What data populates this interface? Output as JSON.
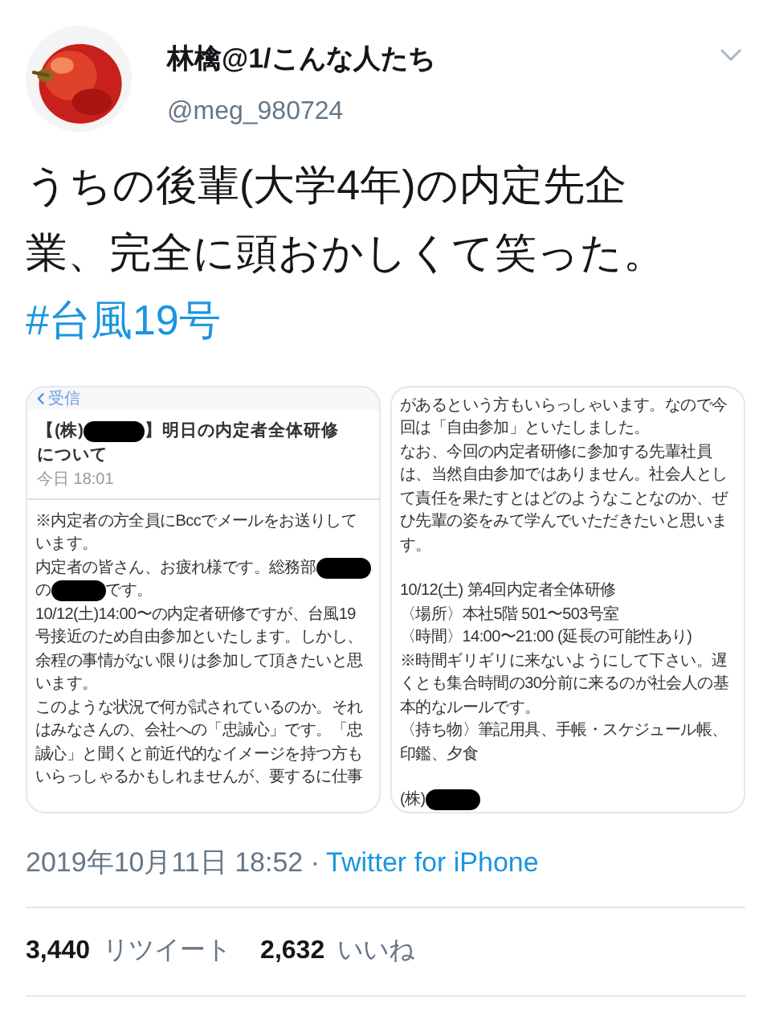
{
  "author": {
    "name": "林檎@1/こんな人たち",
    "handle": "@meg_980724"
  },
  "tweet": {
    "text": "うちの後輩(大学4年)の内定先企業、完全に頭おかしくて笑った。",
    "hashtag": "#台風19号"
  },
  "images": [
    {
      "kind": "mail_header",
      "back_label": "受信",
      "subject_before": "【(株)",
      "subject_after": "】明日の内定者全体研修",
      "subject_continued": "について",
      "time": "今日 18:01",
      "lines": [
        {
          "kind": "text",
          "parts": [
            {
              "kind": "text",
              "text": "※内定者の方全員にBccでメールをお送りして"
            }
          ]
        },
        {
          "kind": "text",
          "parts": [
            {
              "kind": "text",
              "text": "います。"
            }
          ]
        },
        {
          "kind": "text",
          "parts": [
            {
              "kind": "text",
              "text": "内定者の皆さん、お疲れ様です。総務部"
            },
            {
              "kind": "redaction"
            }
          ]
        },
        {
          "kind": "text",
          "parts": [
            {
              "kind": "text",
              "text": "の"
            },
            {
              "kind": "redaction"
            },
            {
              "kind": "text",
              "text": "です。"
            }
          ]
        },
        {
          "kind": "text",
          "parts": [
            {
              "kind": "text",
              "text": "10/12(土)14:00〜の内定者研修ですが、台風19"
            }
          ]
        },
        {
          "kind": "text",
          "parts": [
            {
              "kind": "text",
              "text": "号接近のため自由参加といたします。しかし、"
            }
          ]
        },
        {
          "kind": "text",
          "parts": [
            {
              "kind": "text",
              "text": "余程の事情がない限りは参加して頂きたいと思"
            }
          ]
        },
        {
          "kind": "text",
          "parts": [
            {
              "kind": "text",
              "text": "います。"
            }
          ]
        },
        {
          "kind": "text",
          "parts": [
            {
              "kind": "text",
              "text": "このような状況で何が試されているのか。それ"
            }
          ]
        },
        {
          "kind": "text",
          "parts": [
            {
              "kind": "text",
              "text": "はみなさんの、会社への「忠誠心」です。「忠"
            }
          ]
        },
        {
          "kind": "text",
          "parts": [
            {
              "kind": "text",
              "text": "誠心」と聞くと前近代的なイメージを持つ方も"
            }
          ]
        },
        {
          "kind": "text",
          "parts": [
            {
              "kind": "text",
              "text": "いらっしゃるかもしれませんが、要するに仕事"
            }
          ]
        }
      ]
    },
    {
      "kind": "mail_body",
      "lines": [
        {
          "kind": "text",
          "parts": [
            {
              "kind": "text",
              "text": "があるという方もいらっしゃいます。なので今"
            }
          ]
        },
        {
          "kind": "text",
          "parts": [
            {
              "kind": "text",
              "text": "回は「自由参加」といたしました。"
            }
          ]
        },
        {
          "kind": "text",
          "parts": [
            {
              "kind": "text",
              "text": "なお、今回の内定者研修に参加する先輩社員"
            }
          ]
        },
        {
          "kind": "text",
          "parts": [
            {
              "kind": "text",
              "text": "は、当然自由参加ではありません。社会人とし"
            }
          ]
        },
        {
          "kind": "text",
          "parts": [
            {
              "kind": "text",
              "text": "て責任を果たすとはどのようなことなのか、ぜ"
            }
          ]
        },
        {
          "kind": "text",
          "parts": [
            {
              "kind": "text",
              "text": "ひ先輩の姿をみて学んでいただきたいと思いま"
            }
          ]
        },
        {
          "kind": "text",
          "parts": [
            {
              "kind": "text",
              "text": "す。"
            }
          ]
        },
        {
          "kind": "gap"
        },
        {
          "kind": "text",
          "parts": [
            {
              "kind": "text",
              "text": "10/12(土) 第4回内定者全体研修"
            }
          ]
        },
        {
          "kind": "text",
          "parts": [
            {
              "kind": "text",
              "text": "〈場所〉本社5階 501〜503号室"
            }
          ]
        },
        {
          "kind": "text",
          "parts": [
            {
              "kind": "text",
              "text": "〈時間〉14:00〜21:00 (延長の可能性あり)"
            }
          ]
        },
        {
          "kind": "text",
          "parts": [
            {
              "kind": "text",
              "text": "※時間ギリギリに来ないようにして下さい。遅"
            }
          ]
        },
        {
          "kind": "text",
          "parts": [
            {
              "kind": "text",
              "text": "くとも集合時間の30分前に来るのが社会人の基"
            }
          ]
        },
        {
          "kind": "text",
          "parts": [
            {
              "kind": "text",
              "text": "本的なルールです。"
            }
          ]
        },
        {
          "kind": "text",
          "parts": [
            {
              "kind": "text",
              "text": "〈持ち物〉筆記用具、手帳・スケジュール帳、"
            }
          ]
        },
        {
          "kind": "text",
          "parts": [
            {
              "kind": "text",
              "text": "印鑑、夕食"
            }
          ]
        },
        {
          "kind": "gap"
        },
        {
          "kind": "text",
          "parts": [
            {
              "kind": "text",
              "text": "(株)"
            },
            {
              "kind": "redaction"
            }
          ]
        }
      ]
    }
  ],
  "timestamp": {
    "date": "2019年10月11日 18:52 ·",
    "source": "Twitter for iPhone"
  },
  "stats": [
    {
      "count": "3,440",
      "label": "リツイート"
    },
    {
      "count": "2,632",
      "label": "いいね"
    }
  ]
}
